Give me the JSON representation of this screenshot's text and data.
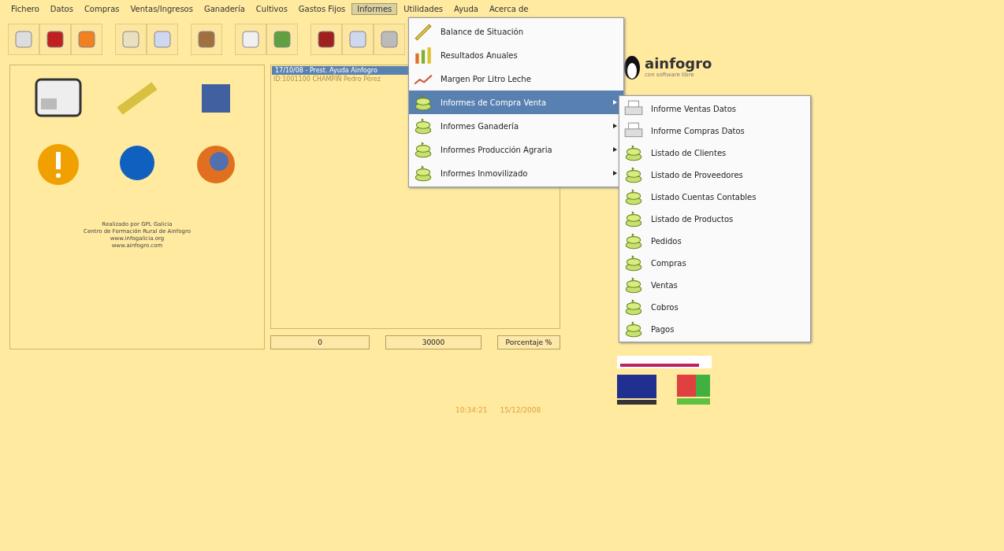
{
  "menubar": [
    {
      "label": "Fichero",
      "selected": false
    },
    {
      "label": "Datos",
      "selected": false
    },
    {
      "label": "Compras",
      "selected": false
    },
    {
      "label": "Ventas/Ingresos",
      "selected": false
    },
    {
      "label": "Ganadería",
      "selected": false
    },
    {
      "label": "Cultivos",
      "selected": false
    },
    {
      "label": "Gastos Fijos",
      "selected": false
    },
    {
      "label": "Informes",
      "selected": true
    },
    {
      "label": "Utilidades",
      "selected": false
    },
    {
      "label": "Ayuda",
      "selected": false
    },
    {
      "label": "Acerca de",
      "selected": false
    }
  ],
  "informes_menu": [
    {
      "label": "Balance de Situación",
      "selected": false,
      "submenu": false,
      "kind": "pencil"
    },
    {
      "label": "Resultados Anuales",
      "selected": false,
      "submenu": false,
      "kind": "bars"
    },
    {
      "label": "Margen Por Litro Leche",
      "selected": false,
      "submenu": false,
      "kind": "chart"
    },
    {
      "label": "Informes de Compra Venta",
      "selected": true,
      "submenu": true,
      "kind": "money"
    },
    {
      "label": "Informes Ganadería",
      "selected": false,
      "submenu": true,
      "kind": "money"
    },
    {
      "label": "Informes Producción Agraria",
      "selected": false,
      "submenu": true,
      "kind": "money"
    },
    {
      "label": "Informes Inmovilizado",
      "selected": false,
      "submenu": true,
      "kind": "money"
    }
  ],
  "submenu": [
    {
      "label": "Informe Ventas Datos",
      "kind": "printer"
    },
    {
      "label": "Informe Compras Datos",
      "kind": "printer"
    },
    {
      "label": "Listado de Clientes",
      "kind": "money"
    },
    {
      "label": "Listado de Proveedores",
      "kind": "money"
    },
    {
      "label": "Listado Cuentas Contables",
      "kind": "money"
    },
    {
      "label": "Listado de Productos",
      "kind": "money"
    },
    {
      "label": "Pedidos",
      "kind": "money"
    },
    {
      "label": "Compras",
      "kind": "money"
    },
    {
      "label": "Ventas",
      "kind": "money"
    },
    {
      "label": "Cobros",
      "kind": "money"
    },
    {
      "label": "Pagos",
      "kind": "money"
    }
  ],
  "credits": [
    "Realizado por GPL Galicia",
    "Centro de Formación Rural de Ainfogro",
    "www.infogalicia.org",
    "www.ainfogro.com"
  ],
  "list": {
    "header": "17/10/08 - Prest. Ayuda Ainfogro",
    "rows": [
      "ID:1001100 CHAMPIÑ Pedro Pérez"
    ]
  },
  "fields": [
    "0",
    "30000",
    "Porcentaje %"
  ],
  "logo": {
    "name": "ainfogro",
    "tagline": "con software libre"
  },
  "status": {
    "time": "10:34:21",
    "date": "15/12/2008"
  }
}
